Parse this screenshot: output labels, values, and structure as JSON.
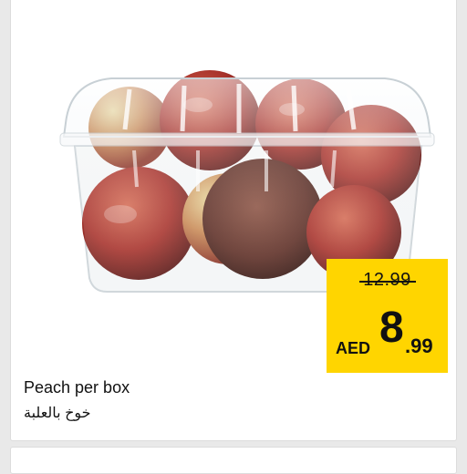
{
  "product": {
    "name_en": "Peach per box",
    "name_ar": "خوخ بالعلبة",
    "image_label": "peach-box-photo"
  },
  "price": {
    "old": "12.99",
    "currency": "AED",
    "main": "8",
    "cents": ".99"
  },
  "colors": {
    "tag_background": "#ffd500",
    "card_background": "#ffffff",
    "page_background": "#e9e9e9"
  }
}
